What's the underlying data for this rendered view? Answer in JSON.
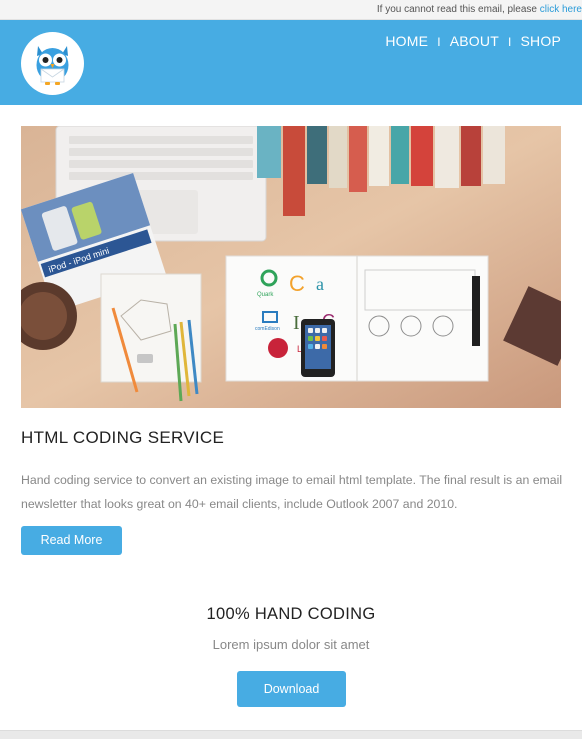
{
  "preheader": {
    "text": "If you cannot read this email, please",
    "link": "click here"
  },
  "nav": {
    "home": "HOME",
    "about": "ABOUT",
    "shop": "SHOP",
    "separator": "I"
  },
  "hero": {
    "ipod_label": "iPod - iPod mini",
    "brand_1": "Quark",
    "brand_2": "comEdison",
    "brand_3": "LG"
  },
  "section1": {
    "title": "HTML CODING SERVICE",
    "description": "Hand coding service to convert an existing image to email html template. The final result is an email newsletter that looks great on 40+ email clients, include Outlook 2007 and 2010.",
    "button": "Read More"
  },
  "section2": {
    "title": "100% HAND CODING",
    "subtitle": "Lorem ipsum dolor sit amet",
    "button": "Download"
  },
  "colors": {
    "accent": "#47ace3",
    "link": "#2a9bd8",
    "title": "#222222",
    "body": "#888888"
  },
  "icons": {
    "logo": "owl-envelope-icon"
  }
}
